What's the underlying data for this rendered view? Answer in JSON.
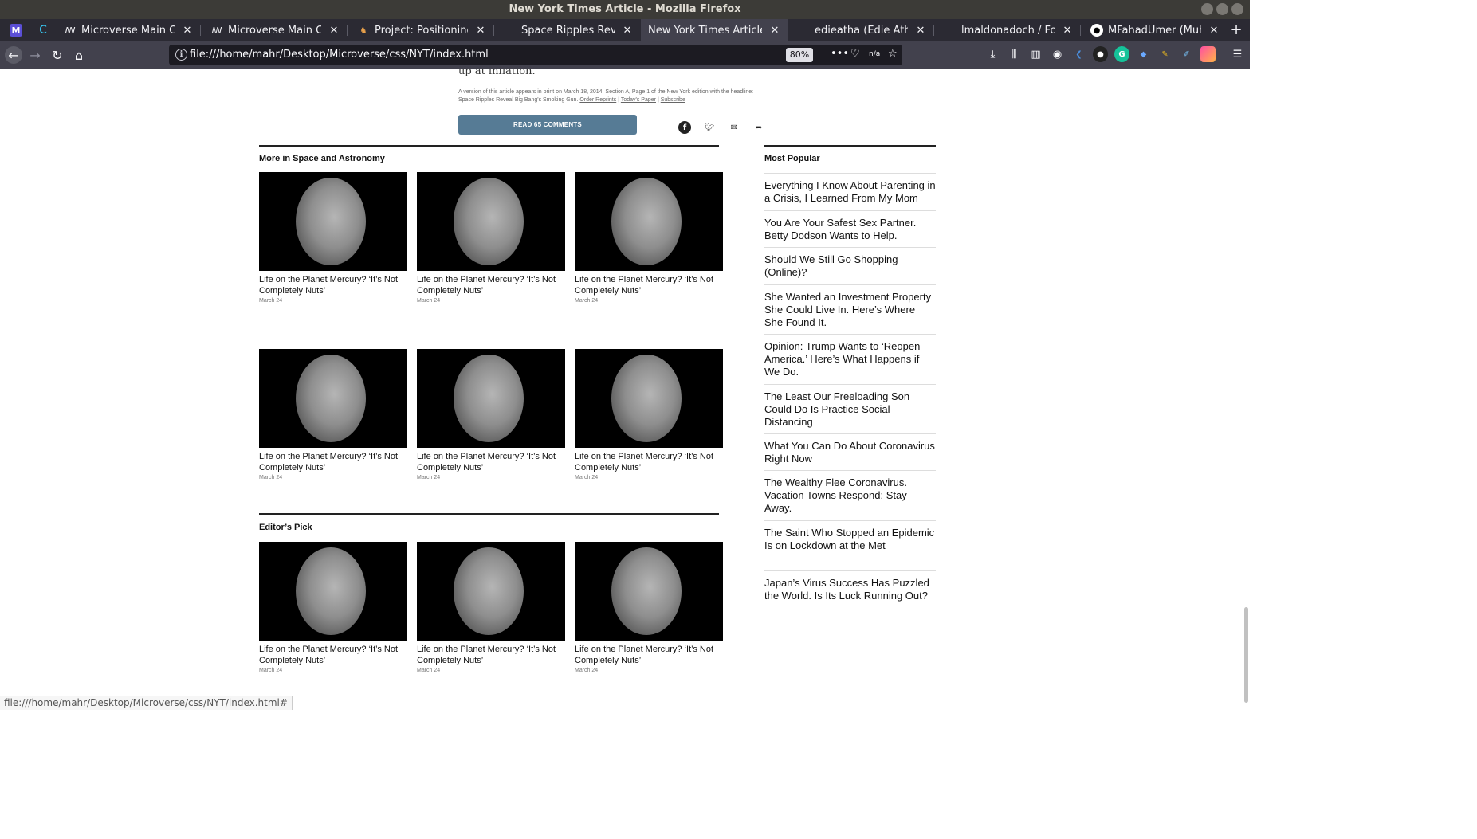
{
  "window": {
    "title": "New York Times Article - Mozilla Firefox"
  },
  "tabs": [
    {
      "label": "",
      "icon": "microverse-icon"
    },
    {
      "label": "",
      "icon": "loading-icon"
    },
    {
      "label": "Microverse Main Curricu",
      "icon": "microverse-icon"
    },
    {
      "label": "Microverse Main Curricu",
      "icon": "microverse-icon"
    },
    {
      "label": "Project: Positioning and",
      "icon": "owl-icon"
    },
    {
      "label": "Space Ripples Reveal Bi",
      "icon": ""
    },
    {
      "label": "New York Times Article",
      "icon": "",
      "active": true
    },
    {
      "label": "edieatha (Edie Atha)",
      "icon": ""
    },
    {
      "label": "lmaldonadoch / Follower",
      "icon": ""
    },
    {
      "label": "MFahadUmer (Muhamm",
      "icon": "github-icon"
    }
  ],
  "navbar": {
    "url": "file:///home/mahr/Desktop/Microverse/css/NYT/index.html",
    "zoom": "80%",
    "na_label": "n/a"
  },
  "article": {
    "quote_tail": "up at inflation.”",
    "print_note": "A version of this article appears in print on March 18, 2014, Section A, Page 1 of the New York edition with the headline: Space Ripples Reveal Big Bang's Smoking Gun.",
    "order_reprints": "Order Reprints",
    "todays_paper": "Today's Paper",
    "subscribe": "Subscribe",
    "separator": "|",
    "comments_button": "READ 65 COMMENTS"
  },
  "more_section": {
    "heading": "More in Space and Astronomy",
    "cards": [
      {
        "title": "Life on the Planet Mercury? ‘It’s Not Completely Nuts’",
        "date": "March 24"
      },
      {
        "title": "Life on the Planet Mercury? ‘It’s Not Completely Nuts’",
        "date": "March 24"
      },
      {
        "title": "Life on the Planet Mercury? ‘It’s Not Completely Nuts’",
        "date": "March 24"
      },
      {
        "title": "Life on the Planet Mercury? ‘It’s Not Completely Nuts’",
        "date": "March 24"
      },
      {
        "title": "Life on the Planet Mercury? ‘It’s Not Completely Nuts’",
        "date": "March 24"
      },
      {
        "title": "Life on the Planet Mercury? ‘It’s Not Completely Nuts’",
        "date": "March 24"
      }
    ]
  },
  "editors_pick": {
    "heading": "Editor’s Pick",
    "cards": [
      {
        "title": "Life on the Planet Mercury? ‘It’s Not Completely Nuts’",
        "date": "March 24"
      },
      {
        "title": "Life on the Planet Mercury? ‘It’s Not Completely Nuts’",
        "date": "March 24"
      },
      {
        "title": "Life on the Planet Mercury? ‘It’s Not Completely Nuts’",
        "date": "March 24"
      }
    ]
  },
  "most_popular": {
    "heading": "Most Popular",
    "items": [
      "Everything I Know About Parenting in a Crisis, I Learned From My Mom",
      "You Are Your Safest Sex Partner. Betty Dodson Wants to Help.",
      "Should We Still Go Shopping (Online)?",
      "She Wanted an Investment Property She Could Live In. Here’s Where She Found It.",
      "Opinion: Trump Wants to ‘Reopen America.’ Here’s What Happens if We Do.",
      "The Least Our Freeloading Son Could Do Is Practice Social Distancing",
      "What You Can Do About Coronavirus Right Now",
      "The Wealthy Flee Coronavirus. Vacation Towns Respond: Stay Away.",
      "The Saint Who Stopped an Epidemic Is on Lockdown at the Met",
      "Japan’s Virus Success Has Puzzled the World. Is Its Luck Running Out?"
    ]
  },
  "status_bar": {
    "link": "file:///home/mahr/Desktop/Microverse/css/NYT/index.html#"
  },
  "colors": {
    "button_bg": "#567b95",
    "tab_bg": "#2b2a33",
    "active_tab": "#42414d",
    "titlebar": "#3c3b37"
  }
}
